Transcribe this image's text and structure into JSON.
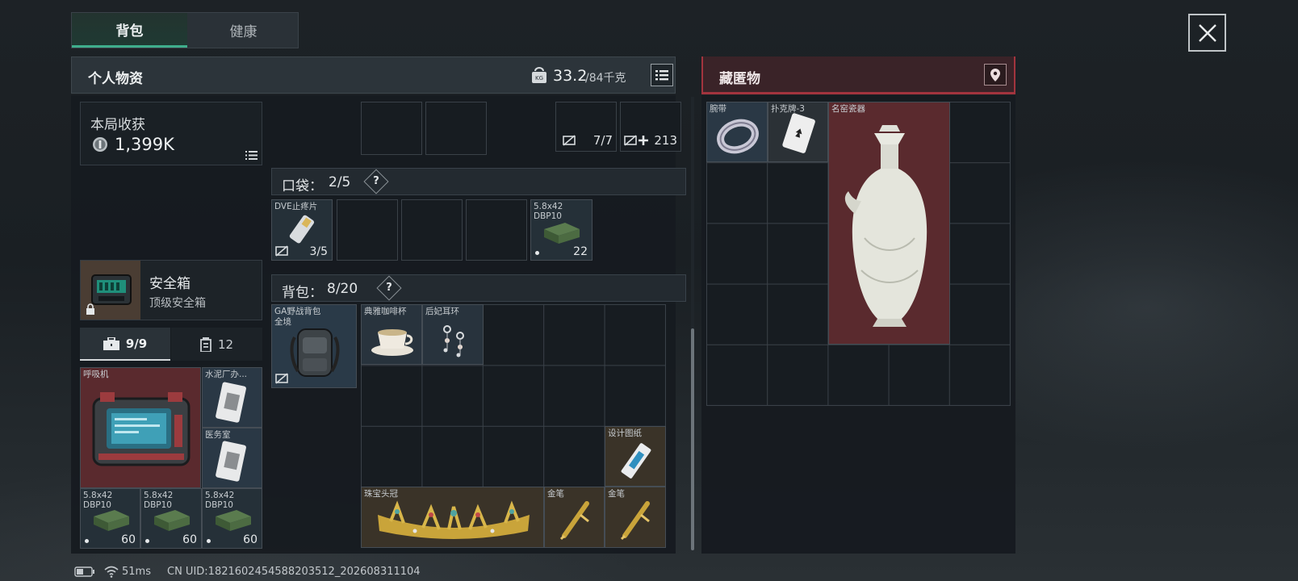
{
  "tabs": {
    "active": "背包",
    "other": "健康"
  },
  "personal": {
    "title": "个人物资",
    "weight": "33.2",
    "weight_max": "/84千克"
  },
  "stash": {
    "title": "藏匿物"
  },
  "earnings": {
    "label": "本局收获",
    "value": "1,399K"
  },
  "top_slots": {
    "a_count": "7/7",
    "b_count": "213"
  },
  "pocket": {
    "label": "口袋：",
    "count": "2/5",
    "help": "?"
  },
  "backpack": {
    "label": "背包：",
    "count": "8/20",
    "help": "?"
  },
  "safe_box": {
    "name": "安全箱",
    "sub": "顶级安全箱"
  },
  "sub_tabs": {
    "tools": "9/9",
    "ammo": "12"
  },
  "pocket_items": [
    {
      "name": "DVE止疼片",
      "qty": "3/5"
    },
    {
      "name": "5.8x42\nDBP10",
      "qty": "22"
    }
  ],
  "bag": {
    "name": "GA野战背包",
    "name2": "全境"
  },
  "backpack_items": {
    "coffee_cup": "典雅咖啡杯",
    "earrings": "后妃耳环",
    "blueprint": "设计图纸",
    "crown": "珠宝头冠",
    "pen1": "金笔",
    "pen2": "金笔"
  },
  "safe_items": {
    "respirator": "呼吸机",
    "cement": "水泥厂办...",
    "medic": "医务室",
    "ammo": [
      {
        "name": "5.8x42\nDBP10",
        "qty": "60"
      },
      {
        "name": "5.8x42\nDBP10",
        "qty": "60"
      },
      {
        "name": "5.8x42\nDBP10",
        "qty": "60"
      }
    ]
  },
  "stash_items": {
    "wristband": "腕带",
    "card": "扑克牌-3",
    "vase": "名窑瓷器"
  },
  "footer": {
    "ping": "51ms",
    "uid": "CN UID:1821602454588203512_202608311104"
  }
}
